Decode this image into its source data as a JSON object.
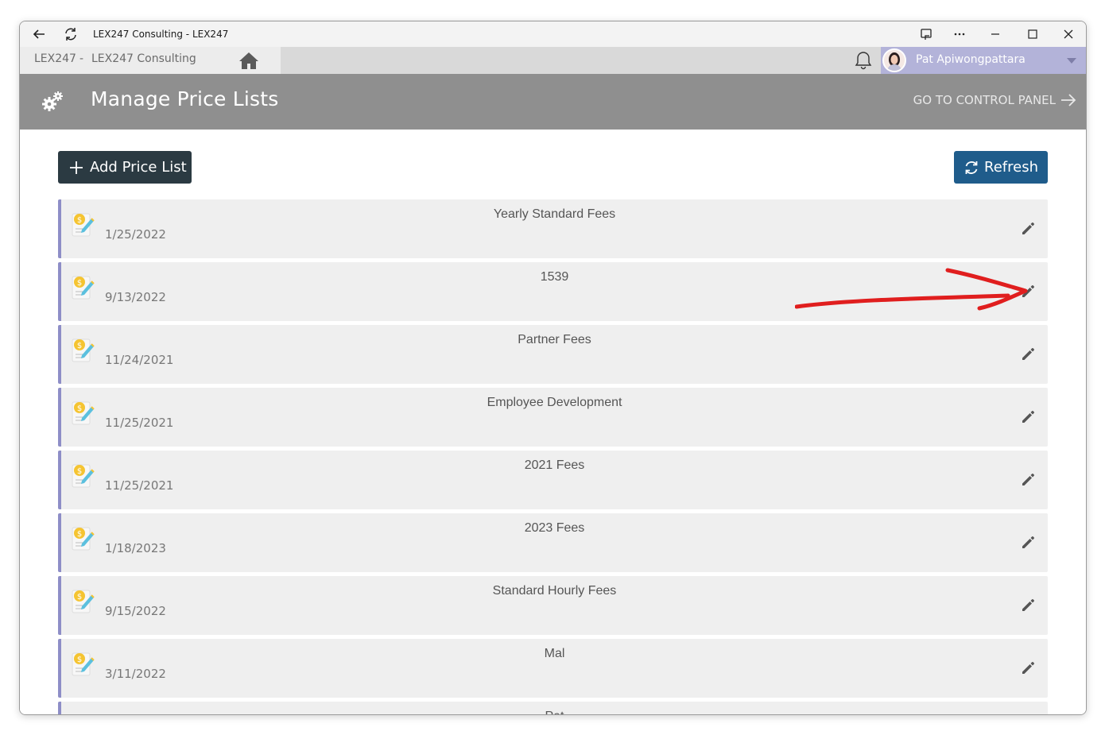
{
  "window": {
    "title": "LEX247 Consulting - LEX247"
  },
  "navbar": {
    "org_code": "LEX247",
    "separator": "-",
    "org_name": "LEX247 Consulting",
    "user_name": "Pat Apiwongpattara"
  },
  "header": {
    "title": "Manage Price Lists",
    "control_panel_link": "GO TO CONTROL PANEL"
  },
  "toolbar": {
    "add_label": "Add Price List",
    "refresh_label": "Refresh"
  },
  "price_lists": [
    {
      "name": "Yearly Standard Fees",
      "date": "1/25/2022"
    },
    {
      "name": "1539",
      "date": "9/13/2022"
    },
    {
      "name": "Partner Fees",
      "date": "11/24/2021"
    },
    {
      "name": "Employee Development",
      "date": "11/25/2021"
    },
    {
      "name": "2021 Fees",
      "date": "11/25/2021"
    },
    {
      "name": "2023 Fees",
      "date": "1/18/2023"
    },
    {
      "name": "Standard Hourly Fees",
      "date": "9/15/2022"
    },
    {
      "name": "Mal",
      "date": "3/11/2022"
    },
    {
      "name": "Pat",
      "date": ""
    }
  ],
  "colors": {
    "header_bg": "#8f8f8f",
    "add_button": "#2b3a42",
    "refresh_button": "#1f5c8b",
    "row_accent": "#8e8ec7",
    "user_area": "#b3b3d9",
    "annotation_arrow": "#e01e1e"
  },
  "icons": {
    "back": "back-arrow-icon",
    "reload": "reload-icon",
    "home": "home-icon",
    "bell": "bell-icon",
    "gears": "gears-icon",
    "edit": "pencil-icon",
    "price_doc": "price-document-icon"
  }
}
